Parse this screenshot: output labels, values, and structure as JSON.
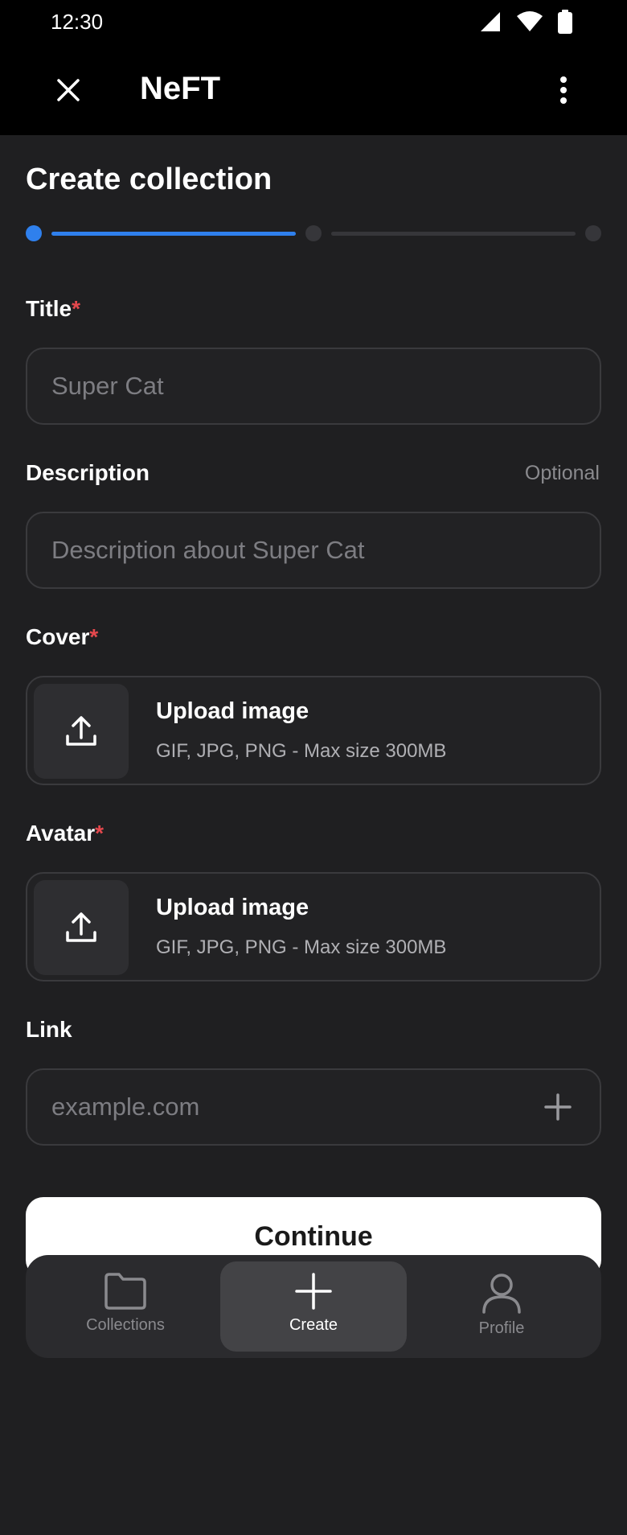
{
  "status_bar": {
    "time": "12:30"
  },
  "app_bar": {
    "title": "NeFT"
  },
  "page": {
    "title": "Create collection",
    "current_step": 1,
    "total_steps": 3
  },
  "form": {
    "title_label": "Title",
    "title_placeholder": "Super Cat",
    "description_label": "Description",
    "description_optional": "Optional",
    "description_placeholder": "Description about Super Cat",
    "cover_label": "Cover",
    "avatar_label": "Avatar",
    "required_mark": "*",
    "upload_title": "Upload image",
    "upload_sub": "GIF, JPG, PNG - Max size 300MB",
    "link_label": "Link",
    "link_placeholder": "example.com"
  },
  "actions": {
    "continue_label": "Continue"
  },
  "bottom_nav": {
    "items": [
      {
        "label": "Collections",
        "icon": "folder-icon",
        "active": false
      },
      {
        "label": "Create",
        "icon": "plus-icon",
        "active": true
      },
      {
        "label": "Profile",
        "icon": "person-icon",
        "active": false
      }
    ]
  },
  "colors": {
    "accent": "#2f80ed",
    "required": "#e5484d",
    "background": "#1f1f21"
  }
}
